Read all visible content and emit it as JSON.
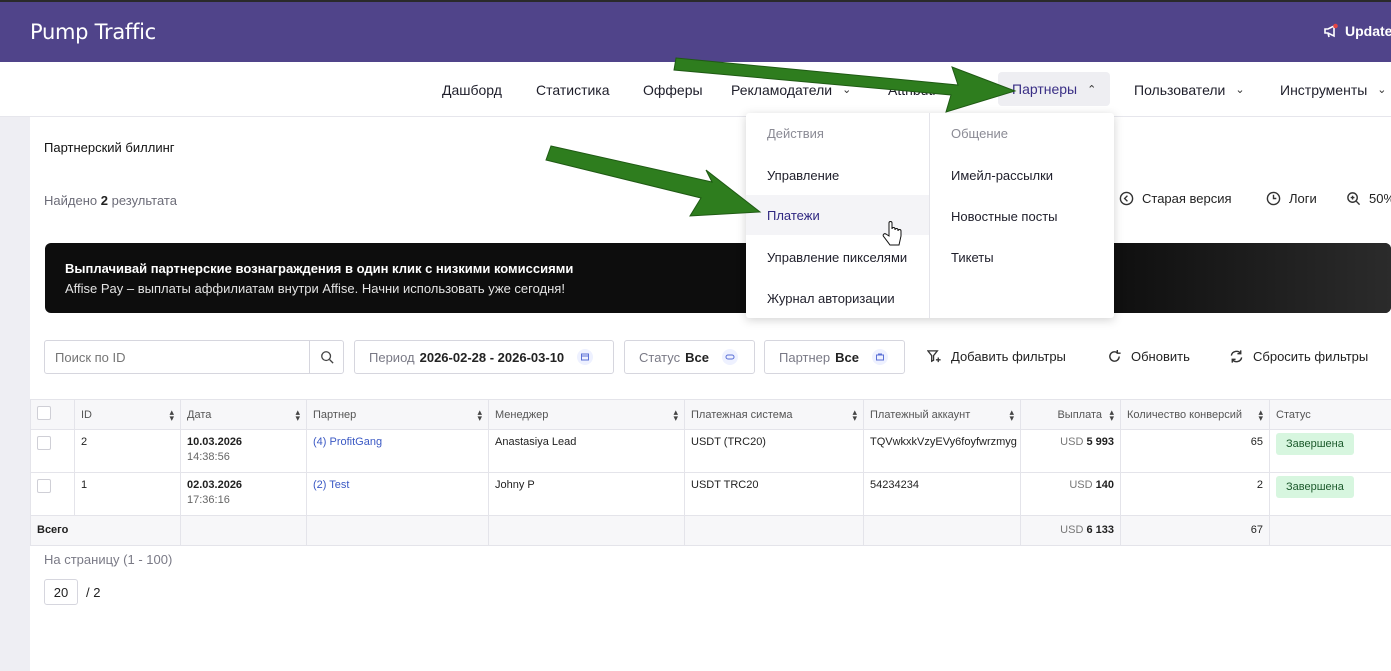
{
  "app": {
    "title": "Pump Traffic",
    "update_label": "Update"
  },
  "nav": {
    "items": [
      {
        "label": "Дашборд"
      },
      {
        "label": "Статистика"
      },
      {
        "label": "Офферы"
      },
      {
        "label": "Рекламодатели"
      },
      {
        "label": "Attributi"
      },
      {
        "label": "Партнеры"
      },
      {
        "label": "Пользователи"
      },
      {
        "label": "Инструменты"
      }
    ]
  },
  "dropdown": {
    "left_header": "Действия",
    "left_items": [
      "Управление",
      "Платежи",
      "Управление пикселями",
      "Журнал авторизации"
    ],
    "right_header": "Общение",
    "right_items": [
      "Имейл-рассылки",
      "Новостные посты",
      "Тикеты"
    ]
  },
  "page": {
    "title": "Партнерский биллинг",
    "found_prefix": "Найдено",
    "found_count": "2",
    "found_suffix": "результата",
    "old_version": "Старая версия",
    "logs": "Логи",
    "zoom": "50%"
  },
  "banner": {
    "line1": "Выплачивай партнерские вознаграждения в один клик с низкими комиссиями",
    "line2": "Affise Pay – выплаты аффилиатам внутри Affise. Начни использовать уже сегодня!"
  },
  "filters": {
    "search_placeholder": "Поиск по ID",
    "period_label": "Период",
    "period_value": "2026-02-28 - 2026-03-10",
    "status_label": "Статус",
    "status_value": "Все",
    "partner_label": "Партнер",
    "partner_value": "Все",
    "add_filters": "Добавить фильтры",
    "refresh": "Обновить",
    "reset": "Сбросить фильтры"
  },
  "table": {
    "headers": {
      "id": "ID",
      "date": "Дата",
      "partner": "Партнер",
      "manager": "Менеджер",
      "system": "Платежная система",
      "account": "Платежный аккаунт",
      "payout": "Выплата",
      "conversions": "Количество конверсий",
      "status": "Статус"
    },
    "rows": [
      {
        "id": "2",
        "date": "10.03.2026",
        "time": "14:38:56",
        "partner": "(4) ProfitGang",
        "manager": "Anastasiya Lead",
        "system": "USDT (TRC20)",
        "account": "TQVwkxkVzyEVy6foyfwrzmyg",
        "currency": "USD",
        "payout": "5 993",
        "conversions": "65",
        "status": "Завершена"
      },
      {
        "id": "1",
        "date": "02.03.2026",
        "time": "17:36:16",
        "partner": "(2) Test",
        "manager": "Johny P",
        "system": "USDT TRC20",
        "account": "54234234",
        "currency": "USD",
        "payout": "140",
        "conversions": "2",
        "status": "Завершена"
      }
    ],
    "total": {
      "label": "Всего",
      "currency": "USD",
      "payout": "6 133",
      "conversions": "67"
    }
  },
  "pagination": {
    "per_page_label": "На страницу (1 - 100)",
    "per_page_value": "20",
    "pages": "/ 2"
  },
  "colors": {
    "header_bg": "#50448a",
    "arrow": "#2e7d1e",
    "badge_bg": "#d7f6df"
  }
}
